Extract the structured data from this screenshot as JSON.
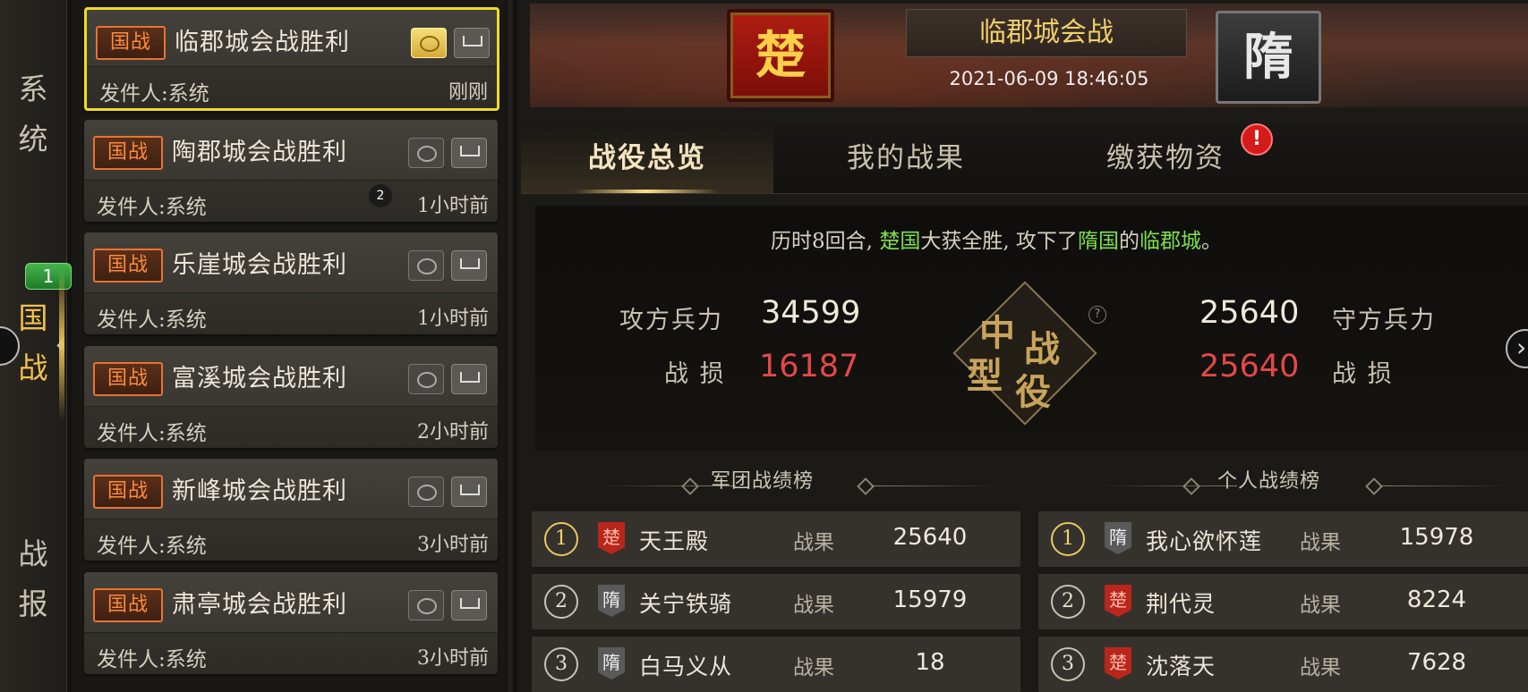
{
  "categories": [
    {
      "line1": "系",
      "line2": "统"
    },
    {
      "line1": "国",
      "line2": "战",
      "badge": "1"
    },
    {
      "line1": "战",
      "line2": "报"
    }
  ],
  "mails": [
    {
      "tag": "国战",
      "title": "临郡城会战胜利",
      "sender": "发件人:系统",
      "time": "刚刚"
    },
    {
      "tag": "国战",
      "title": "陶郡城会战胜利",
      "sender": "发件人:系统",
      "time": "1小时前",
      "badge": "2"
    },
    {
      "tag": "国战",
      "title": "乐崖城会战胜利",
      "sender": "发件人:系统",
      "time": "1小时前"
    },
    {
      "tag": "国战",
      "title": "富溪城会战胜利",
      "sender": "发件人:系统",
      "time": "2小时前"
    },
    {
      "tag": "国战",
      "title": "新峰城会战胜利",
      "sender": "发件人:系统",
      "time": "3小时前"
    },
    {
      "tag": "国战",
      "title": "肃亭城会战胜利",
      "sender": "发件人:系统",
      "time": "3小时前"
    }
  ],
  "banner": {
    "attacker": "楚",
    "defender": "隋",
    "battle_name": "临郡城会战",
    "datetime": "2021-06-09 18:46:05"
  },
  "tabs": {
    "overview": "战役总览",
    "my_results": "我的战果",
    "spoils": "缴获物资",
    "alert": "!"
  },
  "summary": {
    "result_prefix": "历时8回合, ",
    "winner": "楚国",
    "result_mid": "大获全胜, 攻下了",
    "loser": "隋国",
    "result_of": "的",
    "city": "临郡城",
    "result_end": "。",
    "attack_label": "攻方兵力",
    "attack_troops": "34599",
    "attack_loss_label": "战 损",
    "attack_loss": "16187",
    "defend_label": "守方兵力",
    "defend_troops": "25640",
    "defend_loss_label": "战 损",
    "defend_loss": "25640",
    "emblem": [
      "中",
      "型",
      "战",
      "役"
    ],
    "help": "?"
  },
  "legion_board": {
    "title": "军团战绩榜",
    "rows": [
      {
        "rank": "1",
        "nation": "楚",
        "name": "天王殿",
        "label": "战果",
        "value": "25640"
      },
      {
        "rank": "2",
        "nation": "隋",
        "name": "关宁铁骑",
        "label": "战果",
        "value": "15979"
      },
      {
        "rank": "3",
        "nation": "隋",
        "name": "白马义从",
        "label": "战果",
        "value": "18"
      }
    ]
  },
  "personal_board": {
    "title": "个人战绩榜",
    "rows": [
      {
        "rank": "1",
        "nation": "隋",
        "name": "我心欲怀莲",
        "label": "战果",
        "value": "15978"
      },
      {
        "rank": "2",
        "nation": "楚",
        "name": "荆代灵",
        "label": "战果",
        "value": "8224"
      },
      {
        "rank": "3",
        "nation": "楚",
        "name": "沈落天",
        "label": "战果",
        "value": "7628"
      }
    ]
  }
}
